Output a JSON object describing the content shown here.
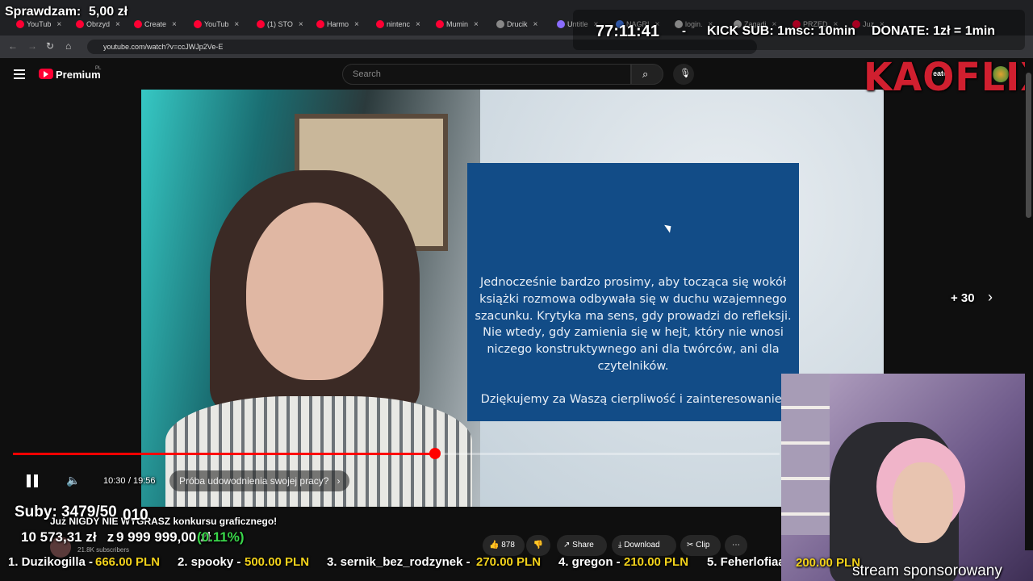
{
  "tabs": [
    {
      "label": "YouTub",
      "color": "#ff0033"
    },
    {
      "label": "Obrzyd",
      "color": "#ff0033"
    },
    {
      "label": "Create",
      "color": "#ff0033"
    },
    {
      "label": "YouTub",
      "color": "#ff0033"
    },
    {
      "label": "(1) STO",
      "color": "#ff0033"
    },
    {
      "label": "Harmo",
      "color": "#ff0033"
    },
    {
      "label": "nintenc",
      "color": "#ff0033"
    },
    {
      "label": "Mumin",
      "color": "#ff0033"
    },
    {
      "label": "Drucik",
      "color": "#888888"
    },
    {
      "label": "Untitle",
      "color": "#8a6cff"
    },
    {
      "label": "NAGRI",
      "color": "#4a86ff"
    },
    {
      "label": "login.",
      "color": "#cccccc"
    },
    {
      "label": "Zagadi",
      "color": "#cccccc"
    },
    {
      "label": "PRZED",
      "color": "#ff0033"
    },
    {
      "label": "Juz",
      "color": "#ff0033"
    }
  ],
  "address": {
    "url": "youtube.com/watch?v=ccJWJp2Ve-E"
  },
  "youtube": {
    "brand": "Premium",
    "region": "PL",
    "search_placeholder": "Search",
    "create_label": "Create"
  },
  "video": {
    "notice_lines": [
      "Jednocześnie bardzo prosimy, aby tocząca się wokół",
      "książki rozmowa odbywała się w duchu wzajemnego",
      "szacunku. Krytyka ma sens, gdy prowadzi do refleksji.",
      "Nie wtedy, gdy zamienia się w hejt, który nie wnosi",
      "niczego konstruktywnego ani dla twórców, ani dla",
      "czytelników."
    ],
    "thanks_line": "Dziękujemy za Waszą cierpliwość i zainteresowanie.",
    "skip_label": "+ 30",
    "time_current": "10:30",
    "time_total": "19:56",
    "time_sep": " / ",
    "chapter": "Próba udowodnienia swojej pracy?",
    "progress": 0.551
  },
  "actions": {
    "likes": "878",
    "share": "Share",
    "download": "Download",
    "clip": "Clip",
    "subscribers": "21.8K subscribers",
    "title_partial": "Już NIGDY NIE WYGRASZ konkursu graficznego!"
  },
  "stream": {
    "check_label": "Sprawdzam:",
    "check_amount": "5,00 zł",
    "timer": "77:11:41",
    "dash": "-",
    "kick_sub": "KICK SUB: 1msc: 10min",
    "donate": "DONATE: 1zł = 1min",
    "logo": "KAOFLIX",
    "subs_label": "Suby: 3479/50",
    "subs_goal": "010",
    "goal_current": "10 573,31 zł",
    "goal_sep": " z ",
    "goal_target": "9 999 999,00 zł",
    "goal_percent": "(0.11%)",
    "sponsored": "stream sponsorowany",
    "donors": [
      {
        "rank": "1. Duzikogilla - ",
        "amount": "666.00 PLN"
      },
      {
        "rank": "2. spooky - ",
        "amount": "500.00 PLN"
      },
      {
        "rank": "3. sernik_bez_rodzynek - ",
        "amount": "270.00 PLN"
      },
      {
        "rank": "4. gregon - ",
        "amount": "210.00 PLN"
      },
      {
        "rank": "5. Feherlofiaa - ",
        "amount": "200.00 PLN"
      }
    ],
    "colors": {
      "green": "#39d64a",
      "yellow": "#f2d21b",
      "red": "#d01f2f"
    }
  }
}
